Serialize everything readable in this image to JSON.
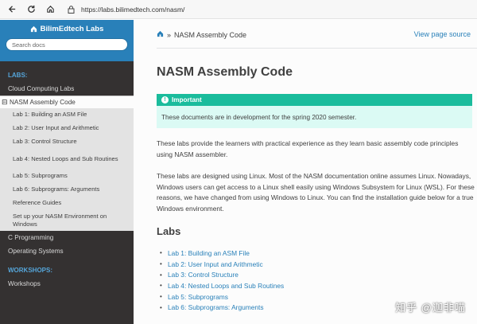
{
  "browser": {
    "url": "https://labs.bilimedtech.com/nasm/"
  },
  "sidebar": {
    "brand": "BilimEdtech Labs",
    "search_placeholder": "Search docs",
    "labs_caption": "LABS:",
    "items_before": [
      "Cloud Computing Labs"
    ],
    "current": "NASM Assembly Code",
    "sub_items": [
      "Lab 1: Building an ASM File",
      "Lab 2: User Input and Arithmetic",
      "Lab 3: Control Structure",
      "Lab 4: Nested Loops and Sub Routines",
      "Lab 5: Subprograms",
      "Lab 6: Subprograms: Arguments",
      "Reference Guides",
      "Set up your NASM Environment on Windows"
    ],
    "items_after": [
      "C Programming",
      "Operating Systems"
    ],
    "workshops_caption": "WORKSHOPS:",
    "workshops_items": [
      "Workshops"
    ]
  },
  "main": {
    "breadcrumb_sep": "»",
    "breadcrumb_current": "NASM Assembly Code",
    "view_source": "View page source",
    "title": "NASM Assembly Code",
    "admonition": {
      "title": "Important",
      "body": "These documents are in development for the spring 2020 semester."
    },
    "para1": "These labs provide the learners with practical experience as they learn basic assembly code principles using NASM assembler.",
    "para2": "These labs are designed using Linux. Most of the NASM documentation online assumes Linux. Nowadays, Windows users can get access to a Linux shell easily using Windows Subsystem for Linux (WSL). For these reasons, we have changed from using Windows to Linux. You can find the installation guide below for a true Windows environment.",
    "labs_heading": "Labs",
    "labs": [
      "Lab 1: Building an ASM File",
      "Lab 2: User Input and Arithmetic",
      "Lab 3: Control Structure",
      "Lab 4: Nested Loops and Sub Routines",
      "Lab 5: Subprograms",
      "Lab 6: Subprograms: Arguments"
    ]
  },
  "watermark": "知乎 @迦非喵",
  "colors": {
    "accent": "#2980b9",
    "sidebar": "#343131",
    "admonition": "#1abc9c"
  }
}
